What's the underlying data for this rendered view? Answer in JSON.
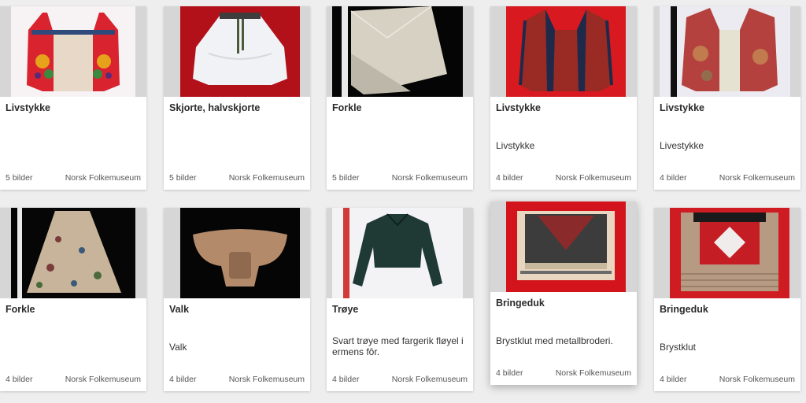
{
  "cards": [
    {
      "title": "Livstykke",
      "description": "",
      "count": "5 bilder",
      "owner": "Norsk Folkemuseum",
      "image": "red-embroidered-bodice"
    },
    {
      "title": "Skjorte, halvskjorte",
      "description": "",
      "count": "5 bilder",
      "owner": "Norsk Folkemuseum",
      "image": "white-shirt"
    },
    {
      "title": "Forkle",
      "description": "",
      "count": "5 bilder",
      "owner": "Norsk Folkemuseum",
      "image": "folded-linen-apron"
    },
    {
      "title": "Livstykke",
      "description": "Livstykke",
      "count": "4 bilder",
      "owner": "Norsk Folkemuseum",
      "image": "red-bodice-dark-trim"
    },
    {
      "title": "Livstykke",
      "description": "Livestykke",
      "count": "4 bilder",
      "owner": "Norsk Folkemuseum",
      "image": "worn-red-bodice"
    },
    {
      "title": "Forkle",
      "description": "",
      "count": "4 bilder",
      "owner": "Norsk Folkemuseum",
      "image": "floral-apron"
    },
    {
      "title": "Valk",
      "description": "Valk",
      "count": "4 bilder",
      "owner": "Norsk Folkemuseum",
      "image": "padded-roll"
    },
    {
      "title": "Trøye",
      "description": "Svart trøye med fargerik fløyel i ermens fôr.",
      "count": "4 bilder",
      "owner": "Norsk Folkemuseum",
      "image": "dark-jacket"
    },
    {
      "title": "Bringeduk",
      "description": "Brystklut med metallbroderi.",
      "count": "4 bilder",
      "owner": "Norsk Folkemuseum",
      "image": "embroidered-breastcloth"
    },
    {
      "title": "Bringeduk",
      "description": "Brystklut",
      "count": "4 bilder",
      "owner": "Norsk Folkemuseum",
      "image": "striped-breastcloth"
    }
  ]
}
